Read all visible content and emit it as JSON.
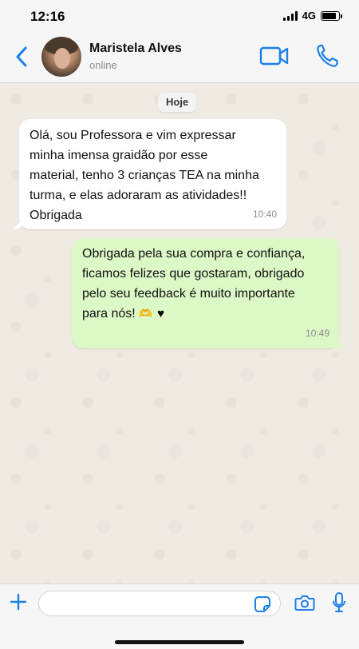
{
  "status_bar": {
    "time": "12:16",
    "network": "4G",
    "battery_level": 0.85
  },
  "header": {
    "contact_name": "Maristela Alves",
    "contact_status": "online",
    "icons": [
      "back-chevron-icon",
      "video-call-icon",
      "phone-call-icon"
    ],
    "accent_color": "#1a7fe8"
  },
  "chat": {
    "date_label": "Hoje",
    "messages": [
      {
        "direction": "incoming",
        "text": "Olá, sou Professora e vim expressar\nminha imensa graidão por esse\nmaterial, tenho 3 crianças TEA na minha\nturma, e elas adoraram as atividades!!\nObrigada",
        "time": "10:40"
      },
      {
        "direction": "outgoing",
        "text": "Obrigada pela sua compra e confiança,\nficamos felizes que gostaram, obrigado\npelo seu feedback é muito importante\npara nós!",
        "emojis": [
          "🫶",
          "♥"
        ],
        "time": "10:49"
      }
    ],
    "colors": {
      "incoming_bubble": "#ffffff",
      "outgoing_bubble": "#dcf8c6",
      "wallpaper": "#efeae2"
    }
  },
  "input_bar": {
    "placeholder": "",
    "icons": [
      "plus-icon",
      "sticker-icon",
      "camera-icon",
      "microphone-icon"
    ]
  }
}
